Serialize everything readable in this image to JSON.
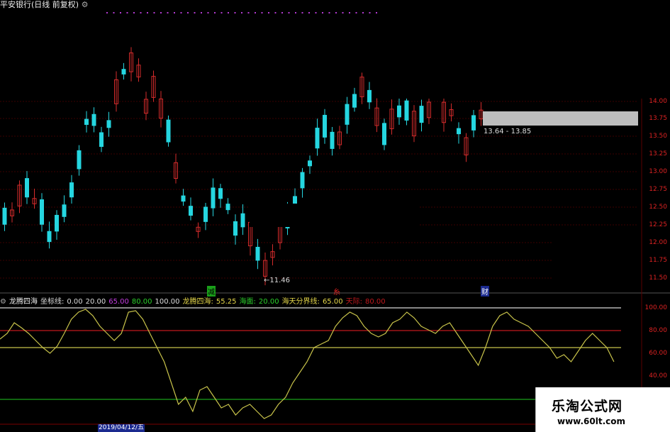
{
  "header": {
    "title": "平安银行(日线 前复权)",
    "gear_icon": "gear-icon"
  },
  "price_axis": [
    "14.00",
    "13.75",
    "13.50",
    "13.25",
    "13.00",
    "12.75",
    "12.50",
    "12.25",
    "12.00",
    "11.75",
    "11.50"
  ],
  "annotations": {
    "low_value": "11.46",
    "range_text": "13.64 - 13.85",
    "marker_jian": "减",
    "marker_cai": "财",
    "marker_red": "糸"
  },
  "indicator": {
    "name": "龙腾四海",
    "label_zuobiao": "坐标线:",
    "v0": "0.00",
    "v20": "20.00",
    "v65": "65.00",
    "v80": "80.00",
    "v100": "100.00",
    "lt_label": "龙腾四海:",
    "lt_val": "55.25",
    "haimian_label": "海面:",
    "haimian_val": "20.00",
    "haitian_label": "海天分界线:",
    "haitian_val": "65.00",
    "tianji_label": "天际:",
    "tianji_val": "80.00"
  },
  "osc_axis": [
    "100.00",
    "80.00",
    "60.00",
    "40.00"
  ],
  "bottom": {
    "date_tab": "2019/04/12/五"
  },
  "logo": {
    "line1": "乐淘公式网",
    "line2": "www.60lt.com"
  },
  "colors": {
    "up": "#d42b2b",
    "down": "#25d6e0",
    "osc_line": "#c8c34a",
    "red_line": "#c0181c",
    "green_line": "#1aa01a",
    "white_line": "#d8d8d8",
    "grid": "#7a0000"
  }
}
